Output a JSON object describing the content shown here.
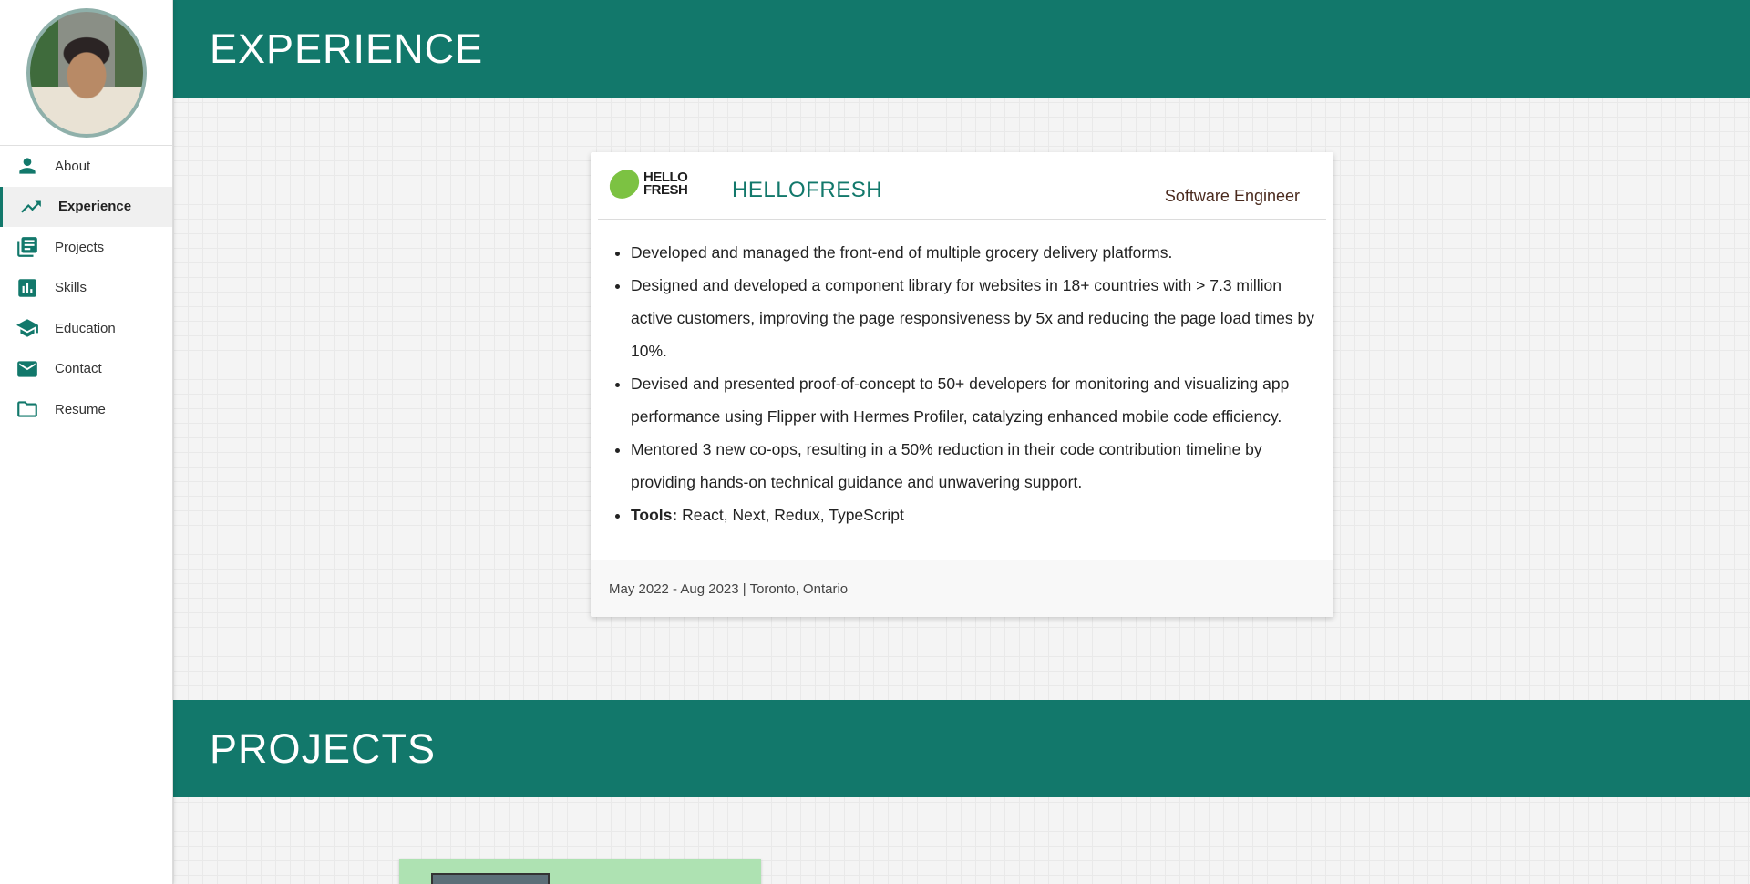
{
  "sidebar": {
    "items": [
      {
        "label": "About",
        "icon": "person-icon"
      },
      {
        "label": "Experience",
        "icon": "trending-up-icon"
      },
      {
        "label": "Projects",
        "icon": "library-books-icon"
      },
      {
        "label": "Skills",
        "icon": "bar-chart-icon"
      },
      {
        "label": "Education",
        "icon": "school-icon"
      },
      {
        "label": "Contact",
        "icon": "mail-icon"
      },
      {
        "label": "Resume",
        "icon": "folder-icon"
      }
    ],
    "active": "Experience"
  },
  "sections": {
    "experience_title": "EXPERIENCE",
    "projects_title": "PROJECTS"
  },
  "experience": {
    "logo_line1": "HELLO",
    "logo_line2": "FRESH",
    "company": "HELLOFRESH",
    "role": "Software Engineer",
    "bullets": [
      "Developed and managed the front-end of multiple grocery delivery platforms.",
      "Designed and developed a component library for websites in 18+ countries with > 7.3 million active customers, improving the page responsiveness by 5x and reducing the page load times by 10%.",
      "Devised and presented proof-of-concept to 50+ developers for monitoring and visualizing app performance using Flipper with Hermes Profiler, catalyzing enhanced mobile code efficiency.",
      "Mentored 3 new co-ops, resulting in a 50% reduction in their code contribution timeline by providing hands-on technical guidance and unwavering support."
    ],
    "tools_label": "Tools:",
    "tools_value": "React, Next, Redux, TypeScript",
    "footer": "May 2022 - Aug 2023 | Toronto, Ontario"
  },
  "colors": {
    "accent": "#12786b",
    "brand_leaf": "#7cc242",
    "role_text": "#4a2a1e"
  }
}
